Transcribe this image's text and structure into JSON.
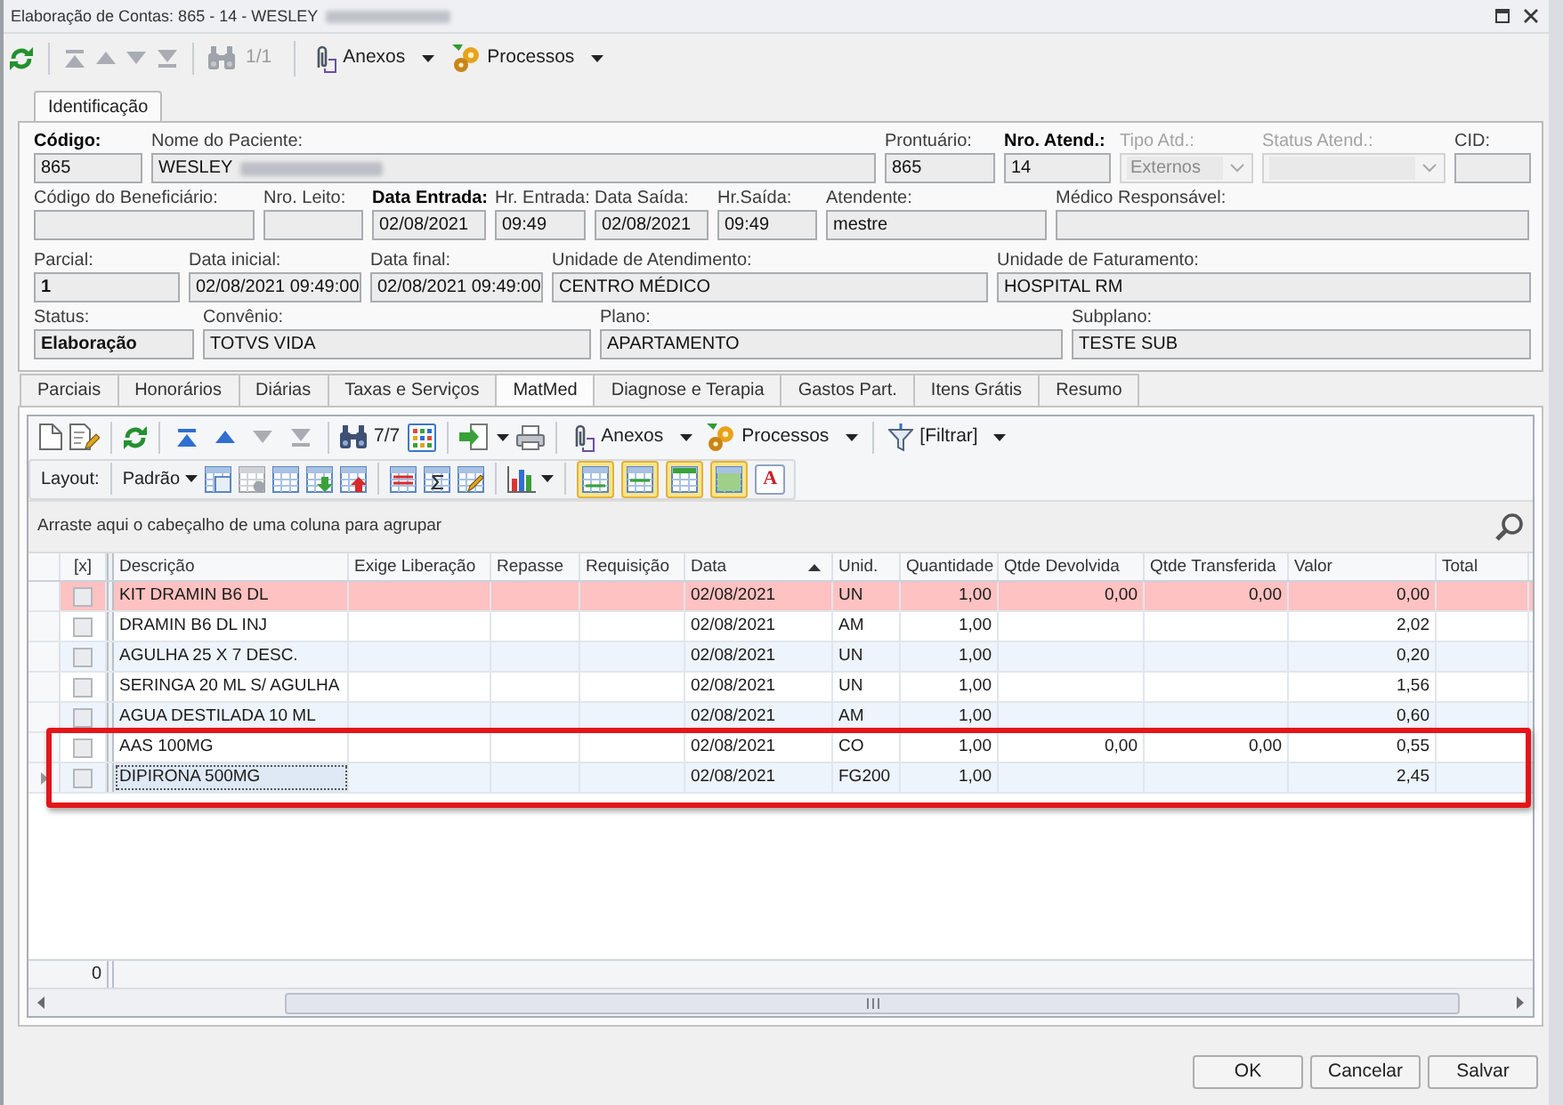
{
  "window": {
    "title": "Elaboração de Contas: 865 - 14 - WESLEY",
    "title_redacted": true
  },
  "toolbar": {
    "nav": [
      {
        "disabled": true
      },
      {
        "disabled": true
      },
      {
        "disabled": true
      },
      {
        "disabled": true
      }
    ],
    "counter": "1/1",
    "counter_disabled": true,
    "menus": [
      {
        "label": "Anexos"
      },
      {
        "label": "Processos"
      }
    ]
  },
  "header_tabs": [
    {
      "label": "Identificação",
      "selected": true
    }
  ],
  "header_fields": [
    [
      {
        "label": "Código:",
        "value": "865",
        "kind": "text",
        "label_bold": true,
        "disabled": false
      },
      {
        "label": "Nome do Paciente:",
        "value": "WESLEY",
        "kind": "text",
        "redacted": true,
        "disabled": false
      },
      {
        "label": "Prontuário:",
        "value": "865",
        "kind": "text",
        "disabled": false
      },
      {
        "label": "Nro. Atend.:",
        "value": "14",
        "kind": "text",
        "label_bold": true,
        "disabled": false
      },
      {
        "label": "Tipo Atd.:",
        "value": "Externos",
        "kind": "select",
        "disabled": true
      },
      {
        "label": "Status Atend.:",
        "kind": "select",
        "disabled": true
      },
      {
        "label": "CID:",
        "kind": "text",
        "disabled": false
      }
    ],
    [
      {
        "label": "Código do Beneficiário:",
        "kind": "text",
        "disabled": false
      },
      {
        "label": "Nro. Leito:",
        "kind": "text",
        "disabled": false
      },
      {
        "label": "Data Entrada:",
        "value": "02/08/2021",
        "kind": "text",
        "label_bold": true,
        "disabled": false
      },
      {
        "label": "Hr. Entrada:",
        "value": "09:49",
        "kind": "text",
        "disabled": false
      },
      {
        "label": "Data Saída:",
        "value": "02/08/2021",
        "kind": "text",
        "disabled": false
      },
      {
        "label": "Hr.Saída:",
        "value": "09:49",
        "kind": "text",
        "disabled": false
      },
      {
        "label": "Atendente:",
        "value": "mestre",
        "kind": "text",
        "disabled": false
      },
      {
        "label": "Médico Responsável:",
        "kind": "text",
        "disabled": false
      }
    ],
    [
      {
        "label": "Parcial:",
        "value": "1",
        "kind": "text",
        "value_bold": true,
        "disabled": false
      },
      {
        "label": "Data inicial:",
        "value": "02/08/2021 09:49:00",
        "kind": "text",
        "disabled": false
      },
      {
        "label": "Data final:",
        "value": "02/08/2021 09:49:00",
        "kind": "text",
        "disabled": false
      },
      {
        "label": "Unidade de Atendimento:",
        "value": "CENTRO MÉDICO",
        "kind": "text",
        "disabled": false
      },
      {
        "label": "Unidade de Faturamento:",
        "value": "HOSPITAL RM",
        "kind": "text",
        "disabled": false
      }
    ],
    [
      {
        "label": "Status:",
        "value": "Elaboração",
        "kind": "text",
        "value_bold": true,
        "disabled": false
      },
      {
        "label": "Convênio:",
        "value": "TOTVS VIDA",
        "kind": "text",
        "disabled": false
      },
      {
        "label": "Plano:",
        "value": "APARTAMENTO",
        "kind": "text",
        "disabled": false
      },
      {
        "label": "Subplano:",
        "value": "TESTE SUB",
        "kind": "text",
        "disabled": false
      }
    ]
  ],
  "detail_tabs": [
    {
      "label": "Parciais",
      "selected": false
    },
    {
      "label": "Honorários",
      "selected": false
    },
    {
      "label": "Diárias",
      "selected": false
    },
    {
      "label": "Taxas e Serviços",
      "selected": false
    },
    {
      "label": "MatMed",
      "selected": true
    },
    {
      "label": "Diagnose e Terapia",
      "selected": false
    },
    {
      "label": "Gastos Part.",
      "selected": false
    },
    {
      "label": "Itens Grátis",
      "selected": false
    },
    {
      "label": "Resumo",
      "selected": false
    }
  ],
  "grid_toolbar": {
    "nav": [
      {
        "disabled": false
      },
      {
        "disabled": false
      },
      {
        "disabled": true
      },
      {
        "disabled": true
      }
    ],
    "counter": "7/7",
    "menus": [
      {
        "label": "Anexos"
      },
      {
        "label": "Processos"
      },
      {
        "label": "[Filtrar]"
      }
    ]
  },
  "layout_bar": {
    "label": "Layout:",
    "layout_menu": "Padrão",
    "toggles": [
      {
        "on": true
      },
      {
        "on": true
      },
      {
        "on": true
      },
      {
        "on": true
      },
      {
        "label": "A",
        "on": false
      }
    ]
  },
  "group_panel": {
    "hint": "Arraste aqui o cabeçalho de uma coluna para agrupar"
  },
  "table": {
    "columns": [
      {
        "label": "[x]"
      },
      {
        "label": "Descrição"
      },
      {
        "label": "Exige Liberação"
      },
      {
        "label": "Repasse"
      },
      {
        "label": "Requisição"
      },
      {
        "label": "Data",
        "sort_ascending": true
      },
      {
        "label": "Unid."
      },
      {
        "label": "Quantidade"
      },
      {
        "label": "Qtde Devolvida"
      },
      {
        "label": "Qtde Transferida"
      },
      {
        "label": "Valor"
      },
      {
        "label": "Total"
      }
    ],
    "rows": [
      {
        "checked": false,
        "flagged": true,
        "selected": false,
        "highlighted": false,
        "description": "KIT DRAMIN B6 DL",
        "date": "02/08/2021",
        "unit": "UN",
        "quantity": "1,00",
        "returned": "0,00",
        "transferred": "0,00",
        "value": "0,00"
      },
      {
        "checked": false,
        "flagged": false,
        "selected": false,
        "highlighted": false,
        "description": "DRAMIN B6 DL INJ",
        "date": "02/08/2021",
        "unit": "AM",
        "quantity": "1,00",
        "value": "2,02"
      },
      {
        "checked": false,
        "flagged": false,
        "selected": false,
        "highlighted": false,
        "description": "AGULHA 25 X 7 DESC.",
        "date": "02/08/2021",
        "unit": "UN",
        "quantity": "1,00",
        "value": "0,20"
      },
      {
        "checked": false,
        "flagged": false,
        "selected": false,
        "highlighted": false,
        "description": "SERINGA 20 ML S/ AGULHA",
        "date": "02/08/2021",
        "unit": "UN",
        "quantity": "1,00",
        "value": "1,56"
      },
      {
        "checked": false,
        "flagged": false,
        "selected": false,
        "highlighted": false,
        "description": "AGUA DESTILADA 10 ML",
        "date": "02/08/2021",
        "unit": "AM",
        "quantity": "1,00",
        "value": "0,60"
      },
      {
        "checked": false,
        "flagged": false,
        "selected": false,
        "highlighted": true,
        "description": "AAS 100MG",
        "date": "02/08/2021",
        "unit": "CO",
        "quantity": "1,00",
        "returned": "0,00",
        "transferred": "0,00",
        "value": "0,55"
      },
      {
        "checked": false,
        "flagged": false,
        "selected": true,
        "highlighted": true,
        "description": "DIPIRONA 500MG",
        "date": "02/08/2021",
        "unit": "FG200",
        "quantity": "1,00",
        "value": "2,45"
      }
    ]
  },
  "footer": {
    "count": "0"
  },
  "buttons": [
    {
      "label": "OK"
    },
    {
      "label": "Cancelar"
    },
    {
      "label": "Salvar"
    }
  ]
}
